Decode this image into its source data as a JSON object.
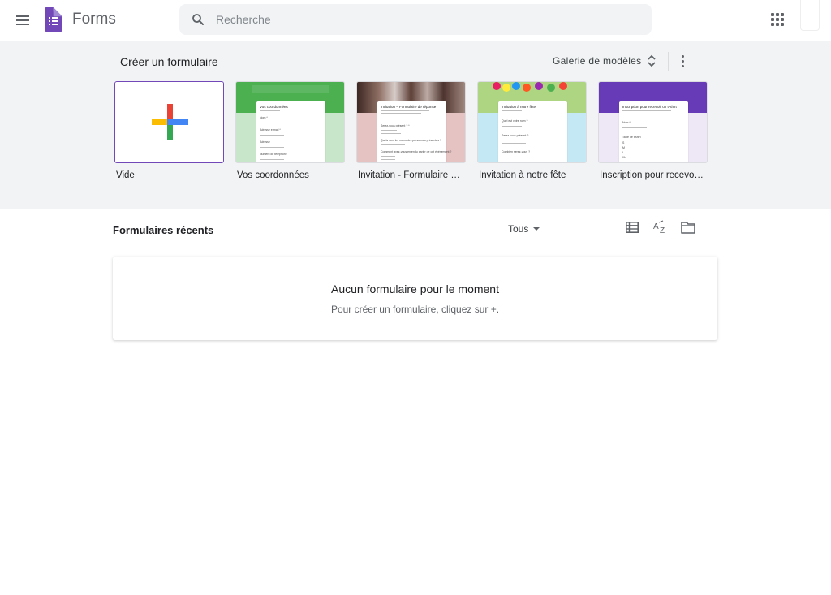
{
  "header": {
    "app_title": "Forms",
    "search_placeholder": "Recherche"
  },
  "templates": {
    "section_title": "Créer un formulaire",
    "gallery_label": "Galerie de modèles",
    "items": [
      {
        "label": "Vide"
      },
      {
        "label": "Vos coordonnées",
        "doc_title": "Vos coordonnées",
        "fields": [
          "Nom *",
          "Adresse e-mail *",
          "Adresse",
          "Numéro de téléphone"
        ],
        "banner_color": "#4caf50",
        "bg_color": "#c8e6c9"
      },
      {
        "label": "Invitation - Formulaire de réponse",
        "doc_title": "Invitation – Formulaire de réponse",
        "fields": [
          "Serez-vous présent ? *",
          "Quels sont les noms des personnes présentes ?",
          "Comment avez-vous entendu parler de cet événement ?"
        ],
        "banner_color": "#5d4037",
        "bg_color": "#e6c3c3"
      },
      {
        "label": "Invitation à notre fête",
        "doc_title": "Invitation à notre fête",
        "fields": [
          "Quel est votre nom ?",
          "Serez-vous présent ?",
          "Combien serez-vous ?"
        ],
        "banner_color": "#81c784",
        "bg_color": "#c5e8f5"
      },
      {
        "label": "Inscription pour recevoir un t-shirt",
        "doc_title": "Inscription pour recevoir un t-shirt",
        "fields": [
          "Nom *",
          "Taille de t-shirt",
          "S",
          "M",
          "L",
          "XL"
        ],
        "banner_color": "#673ab7",
        "bg_color": "#ede7f6"
      }
    ]
  },
  "recent": {
    "section_title": "Formulaires récents",
    "filter_label": "Tous",
    "empty_title": "Aucun formulaire pour le moment",
    "empty_subtitle": "Pour créer un formulaire, cliquez sur +."
  }
}
